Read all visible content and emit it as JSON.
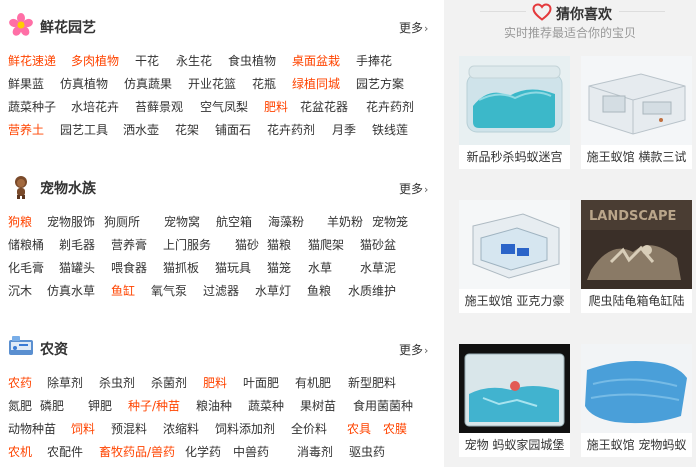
{
  "sections": [
    {
      "title": "鲜花园艺",
      "icon": "flower-icon",
      "more": "更多",
      "rows": [
        [
          {
            "t": "鲜花速递",
            "hot": true
          },
          {
            "t": "多肉植物",
            "hot": true
          },
          {
            "t": "干花"
          },
          {
            "t": "永生花"
          },
          {
            "t": "食虫植物"
          },
          {
            "t": "桌面盆栽",
            "hot": true
          },
          {
            "t": "手捧花"
          }
        ],
        [
          {
            "t": "鲜果蓝"
          },
          {
            "t": "仿真植物"
          },
          {
            "t": "仿真蔬果"
          },
          {
            "t": "开业花篮"
          },
          {
            "t": "花瓶"
          },
          {
            "t": "绿植同城",
            "hot": true
          },
          {
            "t": "园艺方案"
          }
        ],
        [
          {
            "t": "蔬菜种子"
          },
          {
            "t": "水培花卉"
          },
          {
            "t": "苔藓景观"
          },
          {
            "t": "空气凤梨"
          },
          {
            "t": "肥料",
            "hot": true
          },
          {
            "t": "花盆花器"
          },
          {
            "t": "花卉药剂"
          }
        ],
        [
          {
            "t": "营养土",
            "hot": true
          },
          {
            "t": "园艺工具"
          },
          {
            "t": "洒水壶"
          },
          {
            "t": "花架"
          },
          {
            "t": "铺面石"
          },
          {
            "t": "花卉药剂"
          },
          {
            "t": "月季"
          },
          {
            "t": "铁线莲"
          }
        ]
      ]
    },
    {
      "title": "宠物水族",
      "icon": "dog-icon",
      "more": "更多",
      "rows": [
        [
          {
            "t": "狗粮",
            "hot": true
          },
          {
            "t": "宠物服饰"
          },
          {
            "t": "狗厕所"
          },
          {
            "t": "宠物窝"
          },
          {
            "t": "航空箱"
          },
          {
            "t": "海藻粉"
          },
          {
            "t": "羊奶粉"
          },
          {
            "t": "宠物笼"
          }
        ],
        [
          {
            "t": "储粮桶"
          },
          {
            "t": "剃毛器"
          },
          {
            "t": "营养膏"
          },
          {
            "t": "上门服务"
          },
          {
            "t": "猫砂"
          },
          {
            "t": "猫粮"
          },
          {
            "t": "猫爬架"
          },
          {
            "t": "猫砂盆"
          }
        ],
        [
          {
            "t": "化毛膏"
          },
          {
            "t": "猫罐头"
          },
          {
            "t": "喂食器"
          },
          {
            "t": "猫抓板"
          },
          {
            "t": "猫玩具"
          },
          {
            "t": "猫笼"
          },
          {
            "t": "水草"
          },
          {
            "t": "水草泥"
          }
        ],
        [
          {
            "t": "沉木"
          },
          {
            "t": "仿真水草"
          },
          {
            "t": "鱼缸",
            "hot": true
          },
          {
            "t": "氧气泵"
          },
          {
            "t": "过滤器"
          },
          {
            "t": "水草灯"
          },
          {
            "t": "鱼粮"
          },
          {
            "t": "水质维护"
          }
        ]
      ]
    },
    {
      "title": "农资",
      "icon": "farm-icon",
      "more": "更多",
      "rows": [
        [
          {
            "t": "农药",
            "hot": true
          },
          {
            "t": "除草剂"
          },
          {
            "t": "杀虫剂"
          },
          {
            "t": "杀菌剂"
          },
          {
            "t": "肥料",
            "hot": true
          },
          {
            "t": "叶面肥"
          },
          {
            "t": "有机肥"
          },
          {
            "t": "新型肥料"
          }
        ],
        [
          {
            "t": "氮肥"
          },
          {
            "t": "磷肥"
          },
          {
            "t": "钾肥"
          },
          {
            "t": "种子/种苗",
            "hot": true
          },
          {
            "t": "粮油种"
          },
          {
            "t": "蔬菜种"
          },
          {
            "t": "果树苗"
          },
          {
            "t": "食用菌菌种"
          }
        ],
        [
          {
            "t": "动物种苗"
          },
          {
            "t": "饲料",
            "hot": true
          },
          {
            "t": "预混料"
          },
          {
            "t": "浓缩料"
          },
          {
            "t": "饲料添加剂"
          },
          {
            "t": "全价料"
          },
          {
            "t": "农具",
            "hot": true
          },
          {
            "t": "农膜",
            "hot": true
          }
        ],
        [
          {
            "t": "农机",
            "hot": true
          },
          {
            "t": "农配件"
          },
          {
            "t": "畜牧药品/兽药",
            "hot": true
          },
          {
            "t": "化学药"
          },
          {
            "t": "中兽药"
          },
          {
            "t": "消毒剂"
          },
          {
            "t": "驱虫药"
          }
        ]
      ]
    }
  ],
  "guess": {
    "title": "猜你喜欢",
    "subtitle": "实时推荐最适合你的宝贝",
    "cards": [
      {
        "caption": "新品秒杀蚂蚁迷宫",
        "img": "ant-maze-blue"
      },
      {
        "caption": "施王蚁馆 横款三试",
        "img": "clear-acrylic-box"
      },
      {
        "caption": "施王蚁馆 亚克力豪",
        "img": "acrylic-nest"
      },
      {
        "caption": "爬虫陆龟箱龟缸陆",
        "img": "reptile-landscape"
      },
      {
        "caption": "宠物 蚂蚁家园城堡",
        "img": "ant-castle"
      },
      {
        "caption": "施王蚁馆 宠物蚂蚁",
        "img": "blue-towel"
      }
    ]
  },
  "colors": {
    "hot": "#ff4400",
    "text": "#333333",
    "rightBg": "#f2f2f2",
    "heart": "#e4393c"
  }
}
